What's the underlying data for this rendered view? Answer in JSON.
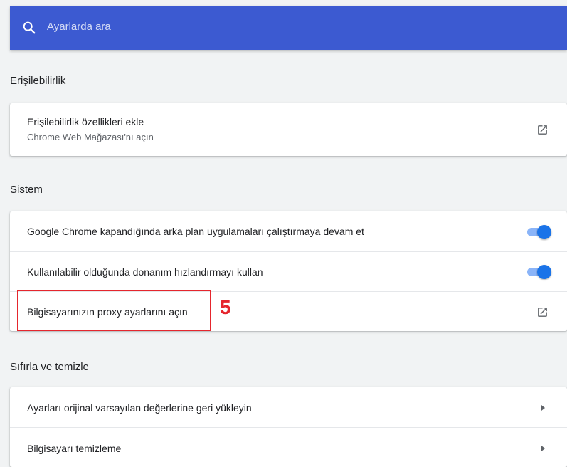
{
  "search": {
    "placeholder": "Ayarlarda ara",
    "icon": "search-icon"
  },
  "accessibility": {
    "title": "Erişilebilirlik",
    "items": [
      {
        "label": "Erişilebilirlik özellikleri ekle",
        "sublabel": "Chrome Web Mağazası'nı açın",
        "control": "external-link-icon"
      }
    ]
  },
  "system": {
    "title": "Sistem",
    "items": [
      {
        "label": "Google Chrome kapandığında arka plan uygulamaları çalıştırmaya devam et",
        "control": "toggle",
        "enabled": true
      },
      {
        "label": "Kullanılabilir olduğunda donanım hızlandırmayı kullan",
        "control": "toggle",
        "enabled": true
      },
      {
        "label": "Bilgisayarınızın proxy ayarlarını açın",
        "control": "external-link-icon"
      }
    ]
  },
  "reset": {
    "title": "Sıfırla ve temizle",
    "items": [
      {
        "label": "Ayarları orijinal varsayılan değerlerine geri yükleyin",
        "control": "arrow-right-icon"
      },
      {
        "label": "Bilgisayarı temizleme",
        "control": "arrow-right-icon"
      }
    ]
  },
  "annotation": {
    "step": "5",
    "color": "#e5262d"
  },
  "colors": {
    "header": "#3c5ad1",
    "toggle_on": "#1a73e8",
    "toggle_track": "#8ab4f8",
    "background": "#f1f3f4"
  }
}
